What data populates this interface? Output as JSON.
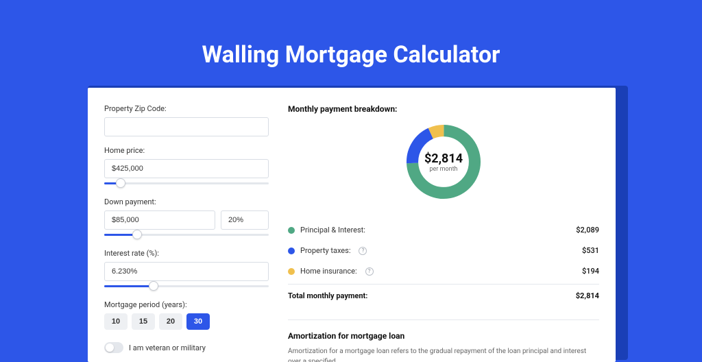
{
  "page_title": "Walling Mortgage Calculator",
  "colors": {
    "principal": "#50a884",
    "taxes": "#2d56e8",
    "insurance": "#f0c04e"
  },
  "form": {
    "zip": {
      "label": "Property Zip Code:",
      "value": ""
    },
    "home_price": {
      "label": "Home price:",
      "value": "$425,000"
    },
    "down_payment": {
      "label": "Down payment:",
      "value": "$85,000",
      "percent": "20%"
    },
    "interest_rate": {
      "label": "Interest rate (%):",
      "value": "6.230%"
    },
    "mortgage_period": {
      "label": "Mortgage period (years):",
      "options": [
        "10",
        "15",
        "20",
        "30"
      ],
      "selected": "30"
    },
    "veteran": {
      "label": "I am veteran or military"
    }
  },
  "breakdown": {
    "title": "Monthly payment breakdown:",
    "center_value": "$2,814",
    "center_sub": "per month",
    "items": [
      {
        "label": "Principal & Interest:",
        "value": "$2,089",
        "color": "principal",
        "has_info": false
      },
      {
        "label": "Property taxes:",
        "value": "$531",
        "color": "taxes",
        "has_info": true
      },
      {
        "label": "Home insurance:",
        "value": "$194",
        "color": "insurance",
        "has_info": true
      }
    ],
    "total_label": "Total monthly payment:",
    "total_value": "$2,814"
  },
  "chart_data": {
    "type": "pie",
    "title": "Monthly payment breakdown:",
    "series": [
      {
        "name": "Principal & Interest",
        "value": 2089,
        "color": "#50a884"
      },
      {
        "name": "Property taxes",
        "value": 531,
        "color": "#2d56e8"
      },
      {
        "name": "Home insurance",
        "value": 194,
        "color": "#f0c04e"
      }
    ],
    "total": 2814,
    "center_label": "$2,814 per month"
  },
  "amortization": {
    "title": "Amortization for mortgage loan",
    "text": "Amortization for a mortgage loan refers to the gradual repayment of the loan principal and interest over a specified"
  }
}
